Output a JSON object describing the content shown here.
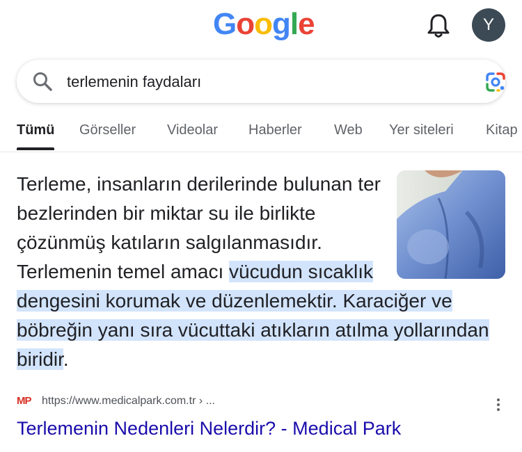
{
  "header": {
    "logo_letters": [
      "G",
      "o",
      "o",
      "g",
      "l",
      "e"
    ],
    "avatar_initial": "Y"
  },
  "search": {
    "query": "terlemenin faydaları"
  },
  "tabs": [
    {
      "label": "Tümü",
      "active": true
    },
    {
      "label": "Görseller"
    },
    {
      "label": "Videolar"
    },
    {
      "label": "Haberler"
    },
    {
      "label": "Web"
    },
    {
      "label": "Yer siteleri"
    },
    {
      "label": "Kitap"
    }
  ],
  "snippet": {
    "text_plain": "Terleme, insanların derilerinde bulunan ter bezlerinden bir miktar su ile birlikte çözünmüş katıların salgılanmasıdır. Terlemenin temel amacı ",
    "text_highlight": "vücudun sıcaklık dengesini korumak ve düzenlemektir. Karaciğer ve böbreğin yanı sıra vücuttaki atıkların atılma yollarından biridir",
    "text_end": "."
  },
  "result": {
    "favicon_text": "MP",
    "url": "https://www.medicalpark.com.tr › ...",
    "title": "Terlemenin Nedenleri Nelerdir? - Medical Park"
  },
  "colors": {
    "link": "#1a0dab",
    "highlight": "#d2e3fc",
    "google_blue": "#4285F4",
    "google_red": "#EA4335",
    "google_yellow": "#FBBC05",
    "google_green": "#34A853"
  },
  "icons": [
    "bell-icon",
    "search-icon",
    "google-lens-icon",
    "more-vert-icon"
  ]
}
